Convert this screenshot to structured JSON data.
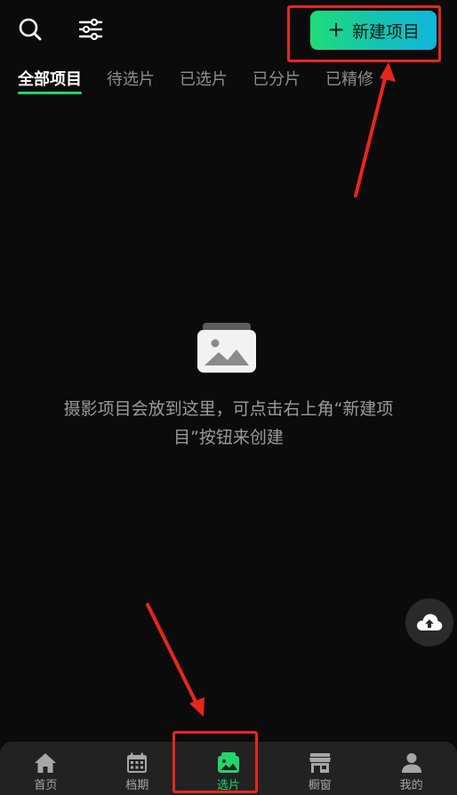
{
  "toolbar": {
    "search_icon": "search-icon",
    "filter_icon": "sliders-icon",
    "new_project_label": "新建项目"
  },
  "tabs": [
    {
      "label": "全部项目",
      "active": true
    },
    {
      "label": "待选片",
      "active": false
    },
    {
      "label": "已选片",
      "active": false
    },
    {
      "label": "已分片",
      "active": false
    },
    {
      "label": "已精修",
      "active": false
    }
  ],
  "empty_state": {
    "icon": "photo-stack-icon",
    "message": "摄影项目会放到这里，可点击右上角“新建项目”按钮来创建"
  },
  "fab": {
    "icon": "cloud-upload-icon"
  },
  "bottom_nav": [
    {
      "label": "首页",
      "icon": "home-icon",
      "active": false
    },
    {
      "label": "档期",
      "icon": "calendar-icon",
      "active": false
    },
    {
      "label": "选片",
      "icon": "photo-icon",
      "active": true
    },
    {
      "label": "橱窗",
      "icon": "storefront-icon",
      "active": false
    },
    {
      "label": "我的",
      "icon": "person-icon",
      "active": false
    }
  ],
  "colors": {
    "background": "#0b0b0b",
    "accent_green": "#20d66b",
    "button_gradient_start": "#1fdc7a",
    "button_gradient_end": "#10b6dc",
    "annotation_red": "#e8261c",
    "nav_background": "#222222"
  }
}
